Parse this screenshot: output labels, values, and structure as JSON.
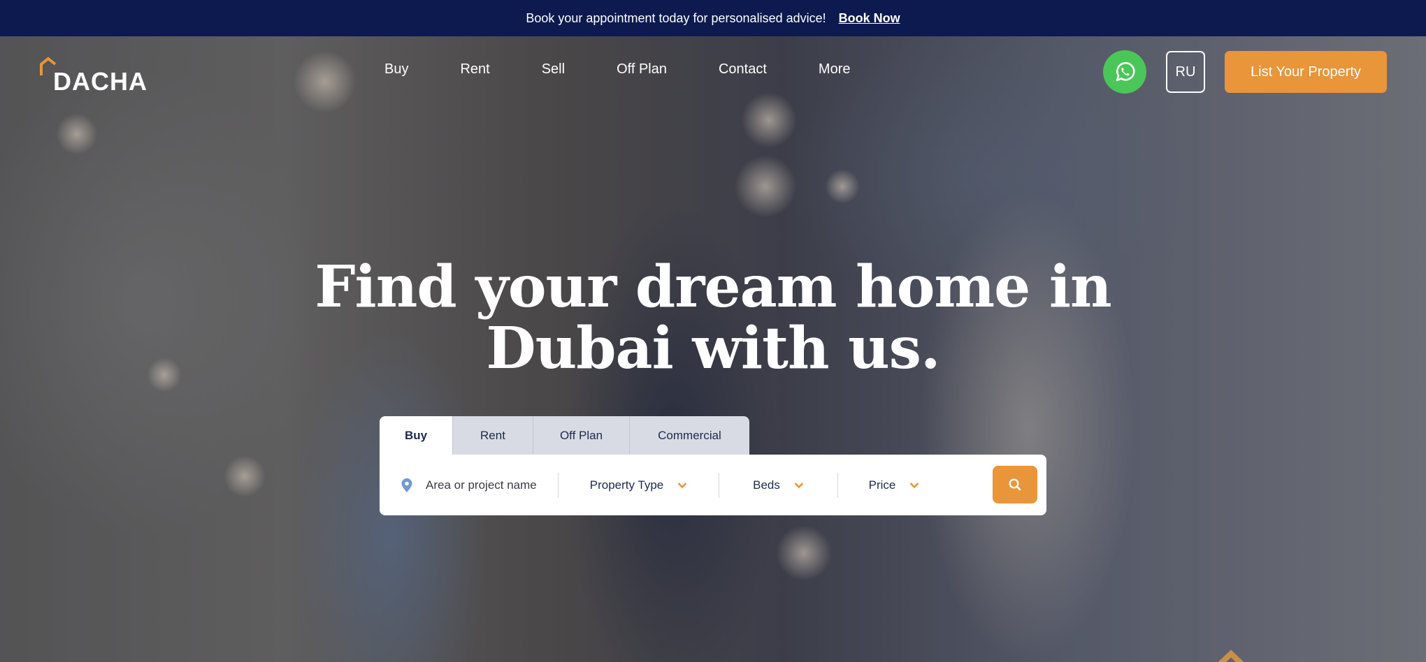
{
  "announcement": {
    "text": "Book your appointment today for personalised advice!",
    "link": "Book Now"
  },
  "brand": {
    "logo_text": "DACHA",
    "accent_color": "#e9953a",
    "navy_color": "#0d1a4f"
  },
  "nav": {
    "items": [
      {
        "label": "Buy"
      },
      {
        "label": "Rent"
      },
      {
        "label": "Sell"
      },
      {
        "label": "Off Plan"
      },
      {
        "label": "Contact"
      },
      {
        "label": "More"
      }
    ],
    "whatsapp_icon": "whatsapp-icon",
    "language": "RU",
    "cta": "List Your Property"
  },
  "hero": {
    "headline_line1": "Find your dream home in",
    "headline_line2": "Dubai with us."
  },
  "search": {
    "tabs": [
      {
        "label": "Buy",
        "active": true
      },
      {
        "label": "Rent",
        "active": false
      },
      {
        "label": "Off Plan",
        "active": false
      },
      {
        "label": "Commercial",
        "active": false
      }
    ],
    "area_placeholder": "Area or project name",
    "property_type": "Property Type",
    "beds": "Beds",
    "price": "Price",
    "search_icon": "search-icon"
  }
}
